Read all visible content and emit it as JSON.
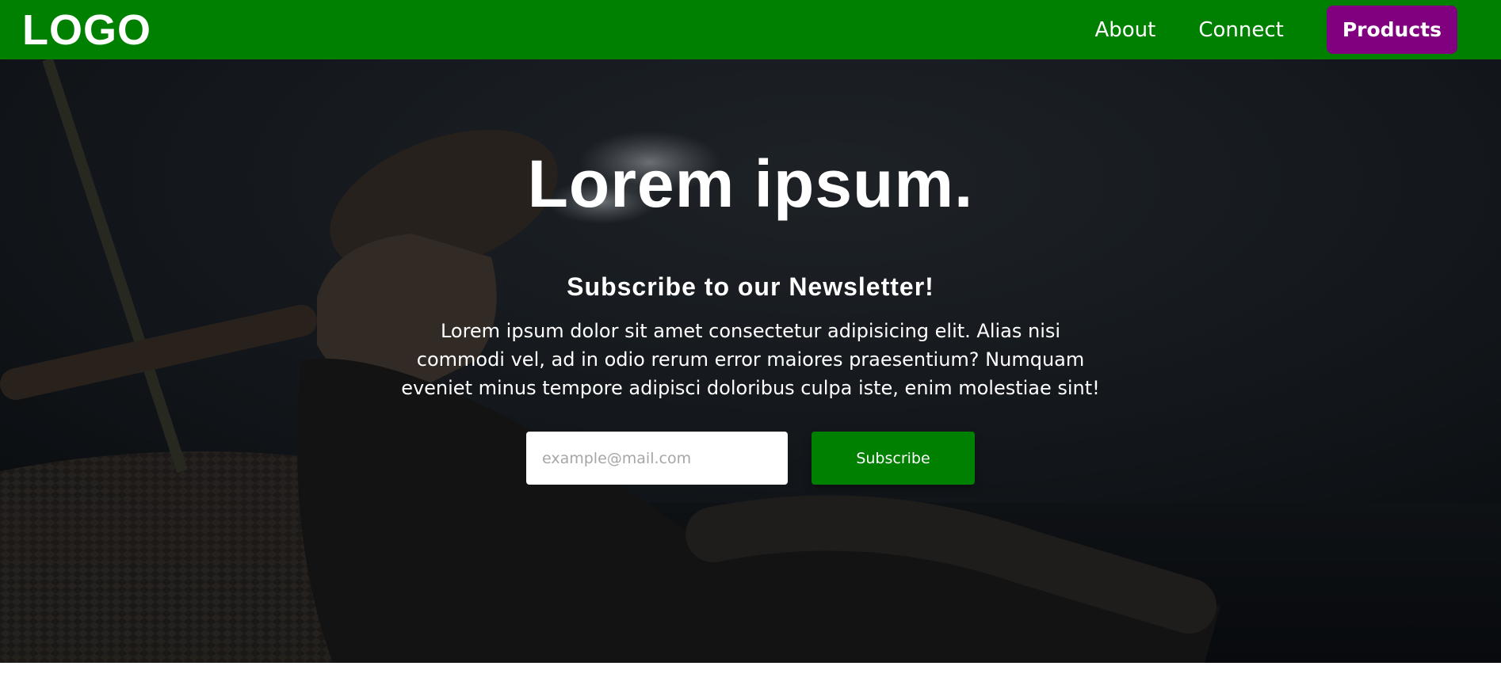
{
  "nav": {
    "logo": "LOGO",
    "links": [
      {
        "label": "About"
      },
      {
        "label": "Connect"
      }
    ],
    "cta_label": "Products"
  },
  "hero": {
    "title": "Lorem ipsum.",
    "subtitle": "Subscribe to our Newsletter!",
    "body": "Lorem ipsum dolor sit amet consectetur adipisicing elit. Alias nisi commodi vel, ad in odio rerum error maiores praesentium? Numquam eveniet minus tempore adipisci doloribus culpa iste, enim molestiae sint!",
    "email_placeholder": "example@mail.com",
    "email_value": "",
    "subscribe_label": "Subscribe"
  },
  "colors": {
    "nav_bg": "#008000",
    "cta_bg": "#800080",
    "button_bg": "#008000"
  }
}
